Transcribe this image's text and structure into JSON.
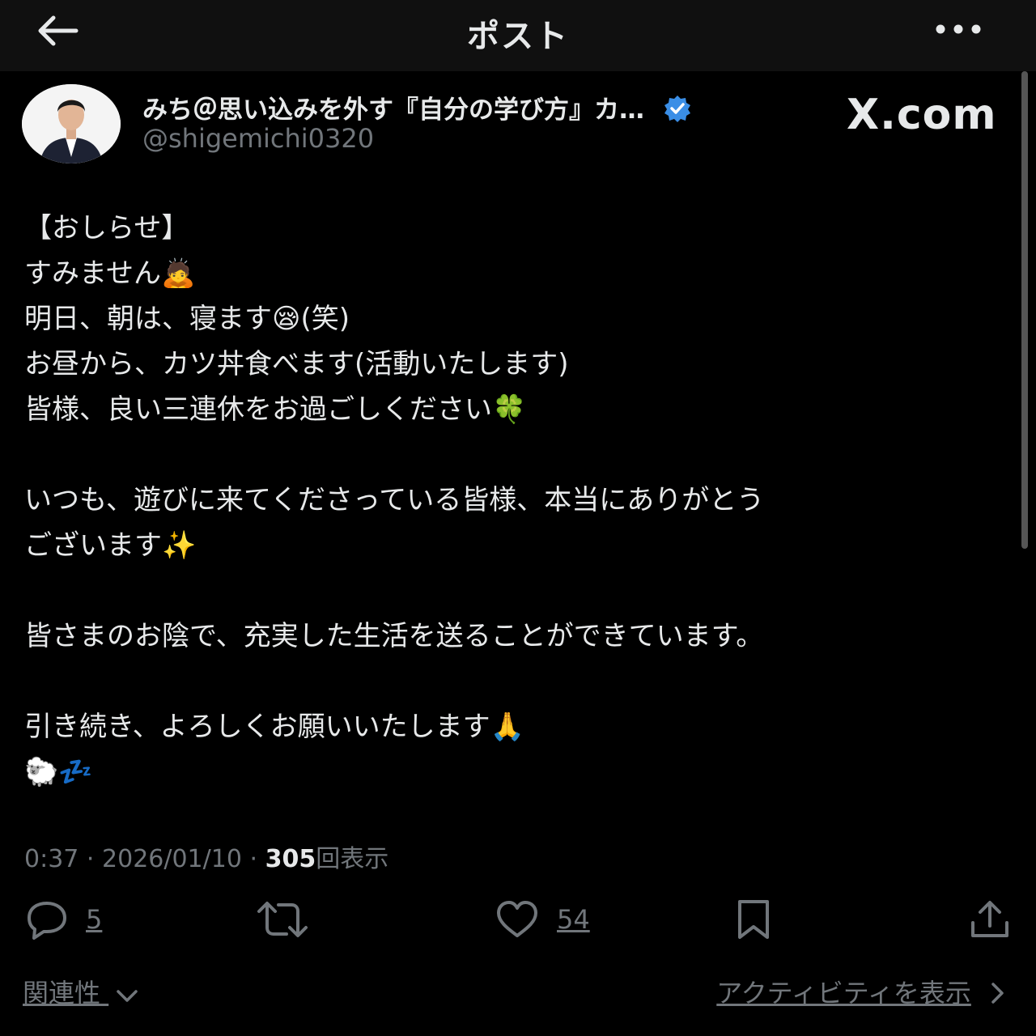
{
  "header": {
    "title": "ポスト",
    "back_icon": "arrow-left-icon",
    "more_icon": "more-horizontal-icon"
  },
  "author": {
    "display_name": "みち＠思い込みを外す『自分の学び方』カ…",
    "handle": "@shigemichi0320",
    "verified_color": "#3a8ee6",
    "watermark": "X.com"
  },
  "post": {
    "lines": [
      "【おしらせ】",
      "すみません🙇",
      "明日、朝は、寝ます😪(笑)",
      "お昼から、カツ丼食べます(活動いたします)",
      "皆様、良い三連休をお過ごしください🍀",
      "",
      "いつも、遊びに来てくださっている皆様、本当にありがとう",
      "ございます✨",
      "",
      "皆さまのお陰で、充実した生活を送ることができています。",
      "",
      "引き続き、よろしくお願いいたします🙏",
      "🐑💤"
    ]
  },
  "meta": {
    "time": "0:37",
    "date": "2026/01/10",
    "separator": "·",
    "views": "305",
    "views_label": "回表示"
  },
  "actions": {
    "reply_count": "5",
    "like_count": "54"
  },
  "footer": {
    "related": "関連性",
    "activity": "アクティビティを表示"
  },
  "colors": {
    "background": "#000000",
    "header_bg": "#101010",
    "text": "#e7e9ea",
    "muted": "#71767b"
  }
}
